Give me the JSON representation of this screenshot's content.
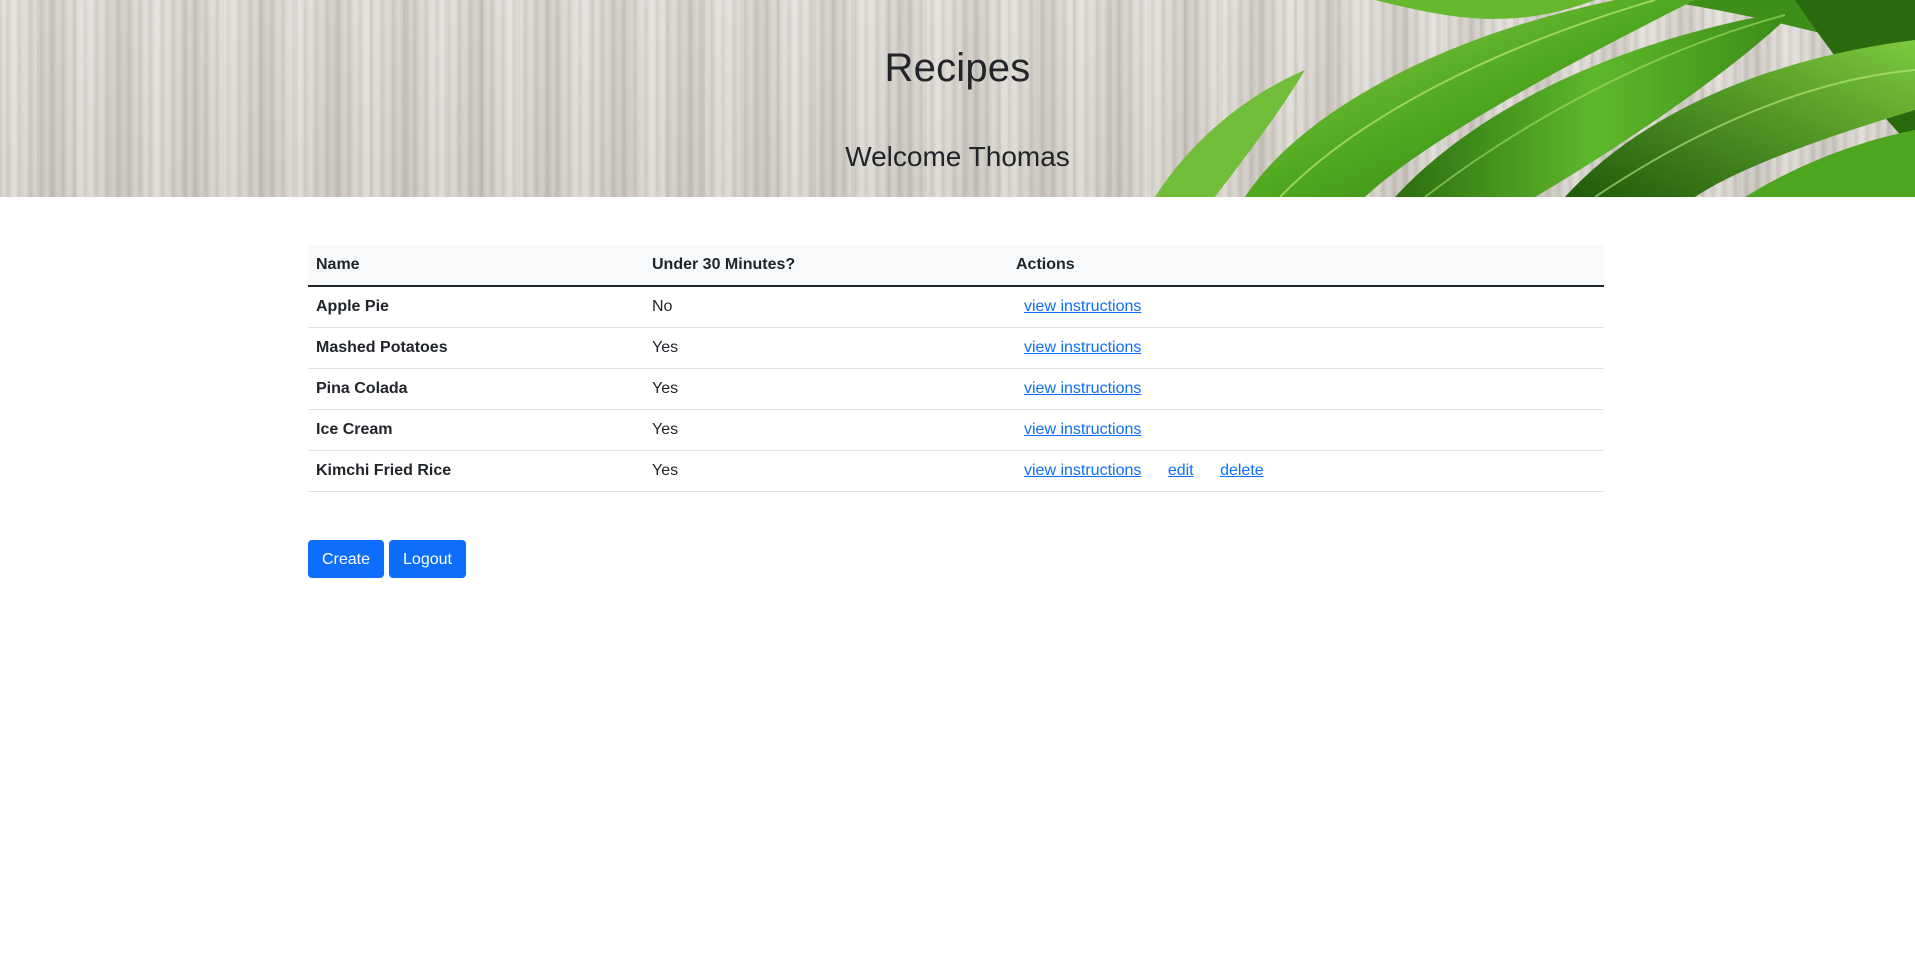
{
  "header": {
    "title": "Recipes",
    "welcome": "Welcome Thomas"
  },
  "table": {
    "columns": [
      "Name",
      "Under 30 Minutes?",
      "Actions"
    ],
    "rows": [
      {
        "name": "Apple Pie",
        "under30": "No",
        "actions": [
          "view instructions"
        ]
      },
      {
        "name": "Mashed Potatoes",
        "under30": "Yes",
        "actions": [
          "view instructions"
        ]
      },
      {
        "name": "Pina Colada",
        "under30": "Yes",
        "actions": [
          "view instructions"
        ]
      },
      {
        "name": "Ice Cream",
        "under30": "Yes",
        "actions": [
          "view instructions"
        ]
      },
      {
        "name": "Kimchi Fried Rice",
        "under30": "Yes",
        "actions": [
          "view instructions",
          "edit",
          "delete"
        ]
      }
    ]
  },
  "buttons": {
    "create": "Create",
    "logout": "Logout"
  },
  "colors": {
    "link": "#0d6efd",
    "primary": "#0d6efd",
    "header_row": "#f8f9fa"
  }
}
